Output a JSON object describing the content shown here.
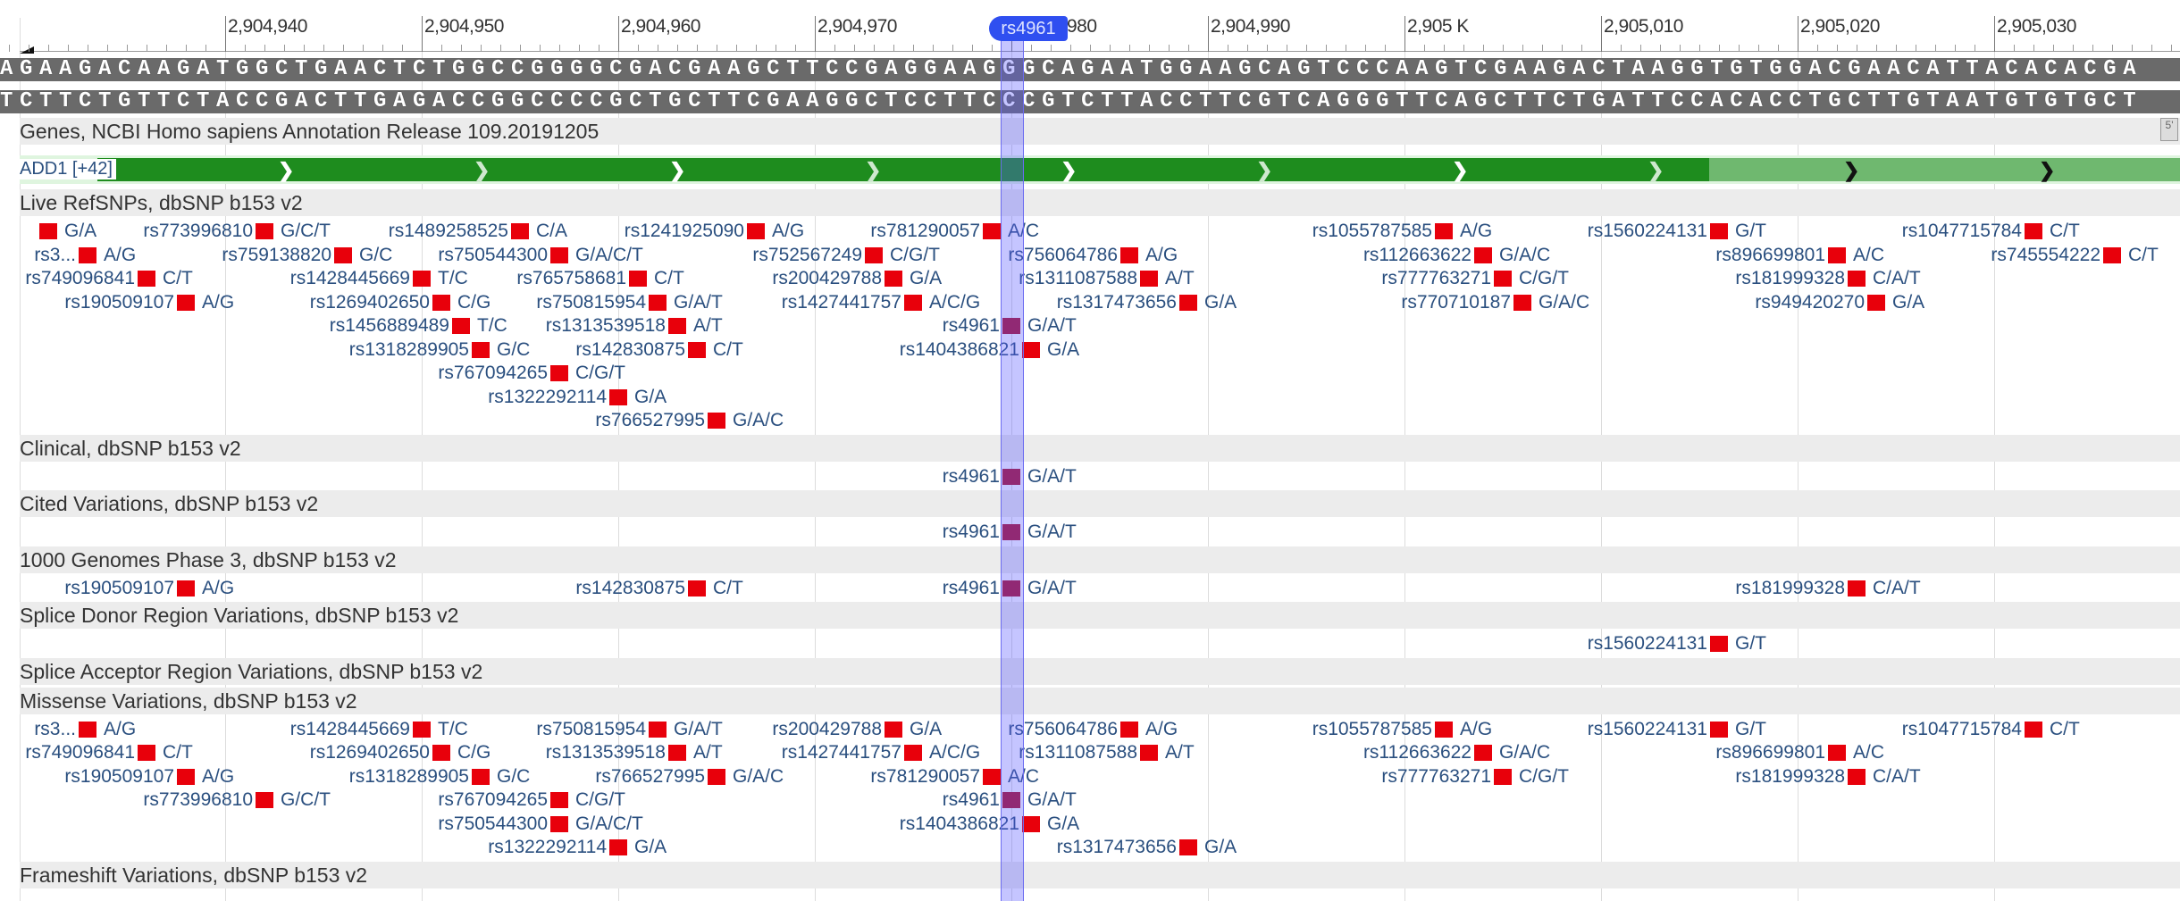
{
  "ruler": {
    "ticks": [
      {
        "value": 2904940,
        "label": "2,904,940"
      },
      {
        "value": 2904950,
        "label": "2,904,950"
      },
      {
        "value": 2904960,
        "label": "2,904,960"
      },
      {
        "value": 2904970,
        "label": "2,904,970"
      },
      {
        "value": 2904980,
        "label": "980"
      },
      {
        "value": 2904990,
        "label": "2,904,990"
      },
      {
        "value": 2905000,
        "label": "2,905 K"
      },
      {
        "value": 2905010,
        "label": "2,905,010"
      },
      {
        "value": 2905020,
        "label": "2,905,020"
      },
      {
        "value": 2905030,
        "label": "2,905,030"
      }
    ],
    "start": 2904929,
    "end": 2905039
  },
  "marker": {
    "label": "rs4961",
    "position": 2904980
  },
  "sequence": {
    "forward": "AGAAGACAAGATGGCTGAACTCTGGCCGGGGCGACGAAGCTTCCGAGGAAGGGCAGAATGGAAGCAGTCCCAAGTCGAAGACTAAGGTGTGGACGAACATTACACACGA",
    "reverse": "TCTTCTGTTCTACCGACTTGAGACCGGCCCCGCTGCTTCGAAGGCTCCTTCCCGTCTTACCTTCGTCAGGGTTCAGCTTCTGATTCCACACCTGCTTGTAATGTGTGCT"
  },
  "genes": {
    "title": "Genes, NCBI Homo sapiens Annotation Release 109.20191205",
    "gene_label": "ADD1 [+42]",
    "cds_end": 2905015,
    "strand_icon_label": "5'",
    "colors": {
      "cds": "#1e8c1e",
      "utr": "#6fb86f"
    }
  },
  "colors": {
    "snp": "#e8000b",
    "highlight": "#5a5aff",
    "header_bg": "#ececec"
  },
  "tracks": [
    {
      "title": "Live RefSNPs, dbSNP b153 v2",
      "rows": [
        [
          {
            "name": "",
            "pos": 2904931,
            "alleles": "G/A"
          },
          {
            "name": "rs773996810",
            "pos": 2904942,
            "alleles": "G/C/T"
          },
          {
            "name": "rs1489258525",
            "pos": 2904955,
            "alleles": "C/A"
          },
          {
            "name": "rs1241925090",
            "pos": 2904967,
            "alleles": "A/G"
          },
          {
            "name": "rs781290057",
            "pos": 2904979,
            "alleles": "A/C"
          },
          {
            "name": "rs1055787585",
            "pos": 2905002,
            "alleles": "A/G"
          },
          {
            "name": "rs1560224131",
            "pos": 2905016,
            "alleles": "G/T"
          },
          {
            "name": "rs1047715784",
            "pos": 2905032,
            "alleles": "C/T"
          }
        ],
        [
          {
            "name": "rs3...",
            "pos": 2904933,
            "alleles": "A/G"
          },
          {
            "name": "rs759138820",
            "pos": 2904946,
            "alleles": "G/C"
          },
          {
            "name": "rs750544300",
            "pos": 2904957,
            "alleles": "G/A/C/T"
          },
          {
            "name": "rs752567249",
            "pos": 2904973,
            "alleles": "C/G/T"
          },
          {
            "name": "rs756064786",
            "pos": 2904986,
            "alleles": "A/G"
          },
          {
            "name": "rs112663622",
            "pos": 2905004,
            "alleles": "G/A/C"
          },
          {
            "name": "rs896699801",
            "pos": 2905022,
            "alleles": "A/C"
          },
          {
            "name": "rs745554222",
            "pos": 2905036,
            "alleles": "C/T"
          }
        ],
        [
          {
            "name": "rs749096841",
            "pos": 2904936,
            "alleles": "C/T"
          },
          {
            "name": "rs1428445669",
            "pos": 2904950,
            "alleles": "T/C"
          },
          {
            "name": "rs765758681",
            "pos": 2904961,
            "alleles": "C/T"
          },
          {
            "name": "rs200429788",
            "pos": 2904974,
            "alleles": "G/A"
          },
          {
            "name": "rs1311087588",
            "pos": 2904987,
            "alleles": "A/T"
          },
          {
            "name": "rs777763271",
            "pos": 2905005,
            "alleles": "C/G/T"
          },
          {
            "name": "rs181999328",
            "pos": 2905023,
            "alleles": "C/A/T"
          }
        ],
        [
          {
            "name": "rs190509107",
            "pos": 2904938,
            "alleles": "A/G"
          },
          {
            "name": "rs1269402650",
            "pos": 2904951,
            "alleles": "C/G"
          },
          {
            "name": "rs750815954",
            "pos": 2904962,
            "alleles": "G/A/T"
          },
          {
            "name": "rs1427441757",
            "pos": 2904975,
            "alleles": "A/C/G"
          },
          {
            "name": "rs1317473656",
            "pos": 2904989,
            "alleles": "G/A"
          },
          {
            "name": "rs770710187",
            "pos": 2905006,
            "alleles": "G/A/C"
          },
          {
            "name": "rs949420270",
            "pos": 2905024,
            "alleles": "G/A"
          }
        ],
        [
          {
            "name": "rs1456889489",
            "pos": 2904952,
            "alleles": "T/C"
          },
          {
            "name": "rs1313539518",
            "pos": 2904963,
            "alleles": "A/T"
          },
          {
            "name": "rs4961",
            "pos": 2904980,
            "alleles": "G/A/T"
          }
        ],
        [
          {
            "name": "rs1318289905",
            "pos": 2904953,
            "alleles": "G/C"
          },
          {
            "name": "rs142830875",
            "pos": 2904964,
            "alleles": "C/T"
          },
          {
            "name": "rs1404386821",
            "pos": 2904981,
            "alleles": "G/A"
          }
        ],
        [
          {
            "name": "rs767094265",
            "pos": 2904957,
            "alleles": "C/G/T"
          }
        ],
        [
          {
            "name": "rs1322292114",
            "pos": 2904960,
            "alleles": "G/A"
          }
        ],
        [
          {
            "name": "rs766527995",
            "pos": 2904965,
            "alleles": "G/A/C"
          }
        ]
      ]
    },
    {
      "title": "Clinical, dbSNP b153 v2",
      "rows": [
        [
          {
            "name": "rs4961",
            "pos": 2904980,
            "alleles": "G/A/T"
          }
        ]
      ]
    },
    {
      "title": "Cited Variations, dbSNP b153 v2",
      "rows": [
        [
          {
            "name": "rs4961",
            "pos": 2904980,
            "alleles": "G/A/T"
          }
        ]
      ]
    },
    {
      "title": "1000 Genomes Phase 3, dbSNP b153 v2",
      "rows": [
        [
          {
            "name": "rs190509107",
            "pos": 2904938,
            "alleles": "A/G"
          },
          {
            "name": "rs142830875",
            "pos": 2904964,
            "alleles": "C/T"
          },
          {
            "name": "rs4961",
            "pos": 2904980,
            "alleles": "G/A/T"
          },
          {
            "name": "rs181999328",
            "pos": 2905023,
            "alleles": "C/A/T"
          }
        ]
      ]
    },
    {
      "title": "Splice Donor Region Variations, dbSNP b153 v2",
      "rows": [
        [
          {
            "name": "rs1560224131",
            "pos": 2905016,
            "alleles": "G/T"
          }
        ]
      ]
    },
    {
      "title": "Splice Acceptor Region Variations, dbSNP b153 v2",
      "rows": []
    },
    {
      "title": "Missense Variations, dbSNP b153 v2",
      "rows": [
        [
          {
            "name": "rs3...",
            "pos": 2904933,
            "alleles": "A/G"
          },
          {
            "name": "rs1428445669",
            "pos": 2904950,
            "alleles": "T/C"
          },
          {
            "name": "rs750815954",
            "pos": 2904962,
            "alleles": "G/A/T"
          },
          {
            "name": "rs200429788",
            "pos": 2904974,
            "alleles": "G/A"
          },
          {
            "name": "rs756064786",
            "pos": 2904986,
            "alleles": "A/G"
          },
          {
            "name": "rs1055787585",
            "pos": 2905002,
            "alleles": "A/G"
          },
          {
            "name": "rs1560224131",
            "pos": 2905016,
            "alleles": "G/T"
          },
          {
            "name": "rs1047715784",
            "pos": 2905032,
            "alleles": "C/T"
          }
        ],
        [
          {
            "name": "rs749096841",
            "pos": 2904936,
            "alleles": "C/T"
          },
          {
            "name": "rs1269402650",
            "pos": 2904951,
            "alleles": "C/G"
          },
          {
            "name": "rs1313539518",
            "pos": 2904963,
            "alleles": "A/T"
          },
          {
            "name": "rs1427441757",
            "pos": 2904975,
            "alleles": "A/C/G"
          },
          {
            "name": "rs1311087588",
            "pos": 2904987,
            "alleles": "A/T"
          },
          {
            "name": "rs112663622",
            "pos": 2905004,
            "alleles": "G/A/C"
          },
          {
            "name": "rs896699801",
            "pos": 2905022,
            "alleles": "A/C"
          }
        ],
        [
          {
            "name": "rs190509107",
            "pos": 2904938,
            "alleles": "A/G"
          },
          {
            "name": "rs1318289905",
            "pos": 2904953,
            "alleles": "G/C"
          },
          {
            "name": "rs766527995",
            "pos": 2904965,
            "alleles": "G/A/C"
          },
          {
            "name": "rs781290057",
            "pos": 2904979,
            "alleles": "A/C"
          },
          {
            "name": "rs777763271",
            "pos": 2905005,
            "alleles": "C/G/T"
          },
          {
            "name": "rs181999328",
            "pos": 2905023,
            "alleles": "C/A/T"
          }
        ],
        [
          {
            "name": "rs773996810",
            "pos": 2904942,
            "alleles": "G/C/T"
          },
          {
            "name": "rs767094265",
            "pos": 2904957,
            "alleles": "C/G/T"
          },
          {
            "name": "rs4961",
            "pos": 2904980,
            "alleles": "G/A/T"
          }
        ],
        [
          {
            "name": "rs750544300",
            "pos": 2904957,
            "alleles": "G/A/C/T"
          },
          {
            "name": "rs1404386821",
            "pos": 2904981,
            "alleles": "G/A"
          }
        ],
        [
          {
            "name": "rs1322292114",
            "pos": 2904960,
            "alleles": "G/A"
          },
          {
            "name": "rs1317473656",
            "pos": 2904989,
            "alleles": "G/A"
          }
        ]
      ]
    },
    {
      "title": "Frameshift Variations, dbSNP b153 v2",
      "rows": []
    }
  ]
}
